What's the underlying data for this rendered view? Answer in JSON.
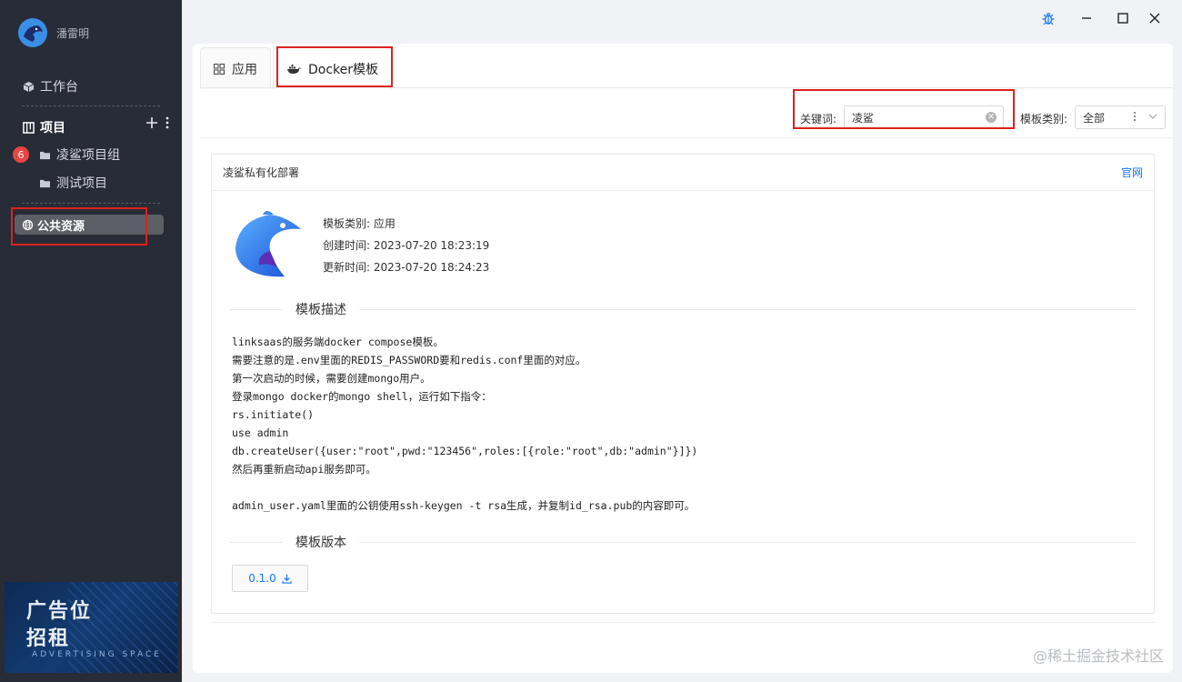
{
  "sidebar": {
    "username": "潘雷明",
    "workbench_label": "工作台",
    "projects_label": "项目",
    "project_group_label": "凌鲨项目组",
    "project_group_badge": "6",
    "test_project_label": "测试项目",
    "public_resources_label": "公共资源",
    "ad": {
      "line1": "广告位",
      "line2": "招租",
      "line3": "ADVERTISING SPACE"
    }
  },
  "tabs": [
    {
      "label": "应用",
      "icon": "grid-icon"
    },
    {
      "label": "Docker模板",
      "icon": "docker-icon"
    }
  ],
  "search": {
    "keyword_label": "关键词:",
    "keyword_value": "凌鲨",
    "category_label": "模板类别:",
    "category_value": "全部"
  },
  "card": {
    "title": "凌鲨私有化部署",
    "link": "官网",
    "meta": {
      "category": "模板类别: 应用",
      "created": "创建时间: 2023-07-20 18:23:19",
      "updated": "更新时间: 2023-07-20 18:24:23"
    },
    "desc_heading": "模板描述",
    "description": "linksaas的服务端docker compose模板。\n需要注意的是.env里面的REDIS_PASSWORD要和redis.conf里面的对应。\n第一次启动的时候，需要创建mongo用户。\n登录mongo docker的mongo shell，运行如下指令：\nrs.initiate()\nuse admin\ndb.createUser({user:\"root\",pwd:\"123456\",roles:[{role:\"root\",db:\"admin\"}]})\n然后再重新启动api服务即可。\n\nadmin_user.yaml里面的公钥使用ssh-keygen -t rsa生成，并复制id_rsa.pub的内容即可。",
    "version_heading": "模板版本",
    "version": "0.1.0"
  },
  "watermark": "@稀土掘金技术社区",
  "colors": {
    "accent": "#1677ff",
    "highlight": "#e02020",
    "sidebar_bg": "#282c36"
  }
}
